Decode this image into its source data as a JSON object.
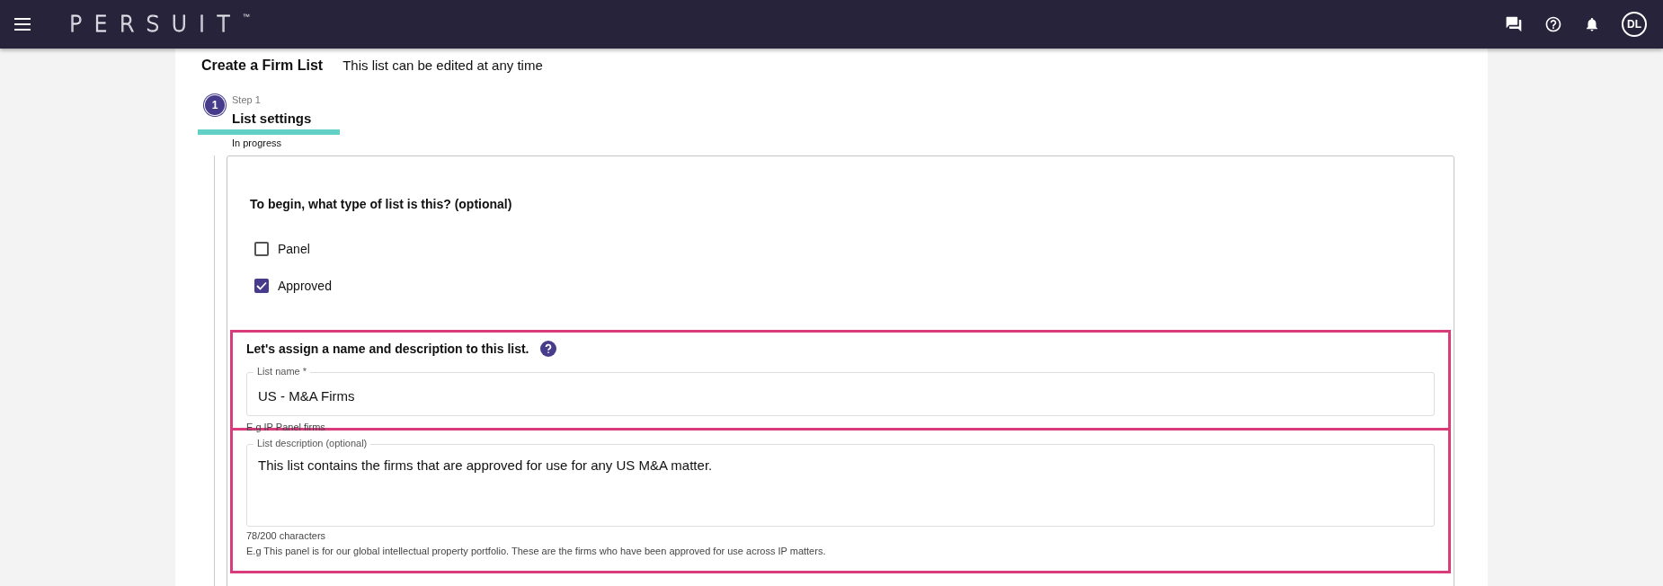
{
  "app_bar": {
    "logo": "PERSUIT",
    "trademark": "™",
    "avatar": "DL"
  },
  "page": {
    "title": "Create a Firm List",
    "subtitle": "This list can be edited at any time"
  },
  "steps": [
    {
      "number": "1",
      "caption": "Step 1",
      "title": "List settings",
      "status": "In progress",
      "selected": true
    }
  ],
  "list_type": {
    "question": "To begin, what type of list is this? (optional)",
    "options": [
      {
        "label": "Panel",
        "checked": false
      },
      {
        "label": "Approved",
        "checked": true
      }
    ]
  },
  "name_section": {
    "heading": "Let's assign a name and description to this list.",
    "highlighted": true
  },
  "list_name": {
    "label": "List name *",
    "value": "US - M&A Firms",
    "hint": "E.g IP Panel firms"
  },
  "list_description": {
    "label": "List description (optional)",
    "value": "This list contains the firms that are approved for use for any US M&A matter.",
    "counter": "78/200 characters",
    "hint": "E.g This panel is for our global intellectual property portfolio. These are the firms who have been approved for use across IP matters.",
    "highlighted": true
  }
}
